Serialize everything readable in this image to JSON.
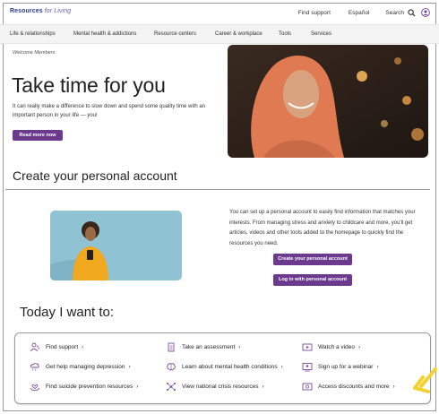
{
  "header": {
    "logo_main": "Resources",
    "logo_italic": "for Living",
    "find_support": "Find support",
    "language": "Español",
    "search_label": "Search"
  },
  "nav": {
    "items": [
      {
        "label": "Life & relationships"
      },
      {
        "label": "Mental health & addictions"
      },
      {
        "label": "Resource centers"
      },
      {
        "label": "Career & workplace"
      },
      {
        "label": "Tools"
      },
      {
        "label": "Services"
      }
    ]
  },
  "hero": {
    "welcome": "Welcome Members",
    "title": "Take time for you",
    "body": "It can really make a difference to slow down and spend some quality time with an important person in your life — you!",
    "button": "Read more now"
  },
  "account": {
    "title": "Create your personal account",
    "body": "You can set up a personal account to easily find information that matches your interests. From managing stress and anxiety to childcare and more, you'll get articles, videos and other tools added to the homepage to quickly find the resources you need.",
    "create_button": "Create your personal account",
    "login_button": "Log in with personal account"
  },
  "today": {
    "title": "Today I want to:",
    "actions": [
      {
        "label": "Find support",
        "icon": "person-support-icon"
      },
      {
        "label": "Take an assessment",
        "icon": "clipboard-icon"
      },
      {
        "label": "Watch a video",
        "icon": "video-icon"
      },
      {
        "label": "Get help managing depression",
        "icon": "cloud-rain-icon"
      },
      {
        "label": "Learn about mental health conditions",
        "icon": "brain-icon"
      },
      {
        "label": "Sign up for a webinar",
        "icon": "webinar-icon"
      },
      {
        "label": "Find suicide prevention resources",
        "icon": "hands-heart-icon"
      },
      {
        "label": "View national crisis resources",
        "icon": "network-icon"
      },
      {
        "label": "Access discounts and more",
        "icon": "discount-icon"
      }
    ],
    "chevron": "›"
  },
  "colors": {
    "brand_purple": "#6b3a8e",
    "logo_blue": "#2d3a8c",
    "icon_purple": "#7a4a9a",
    "highlight_arrow": "#f2d230"
  }
}
